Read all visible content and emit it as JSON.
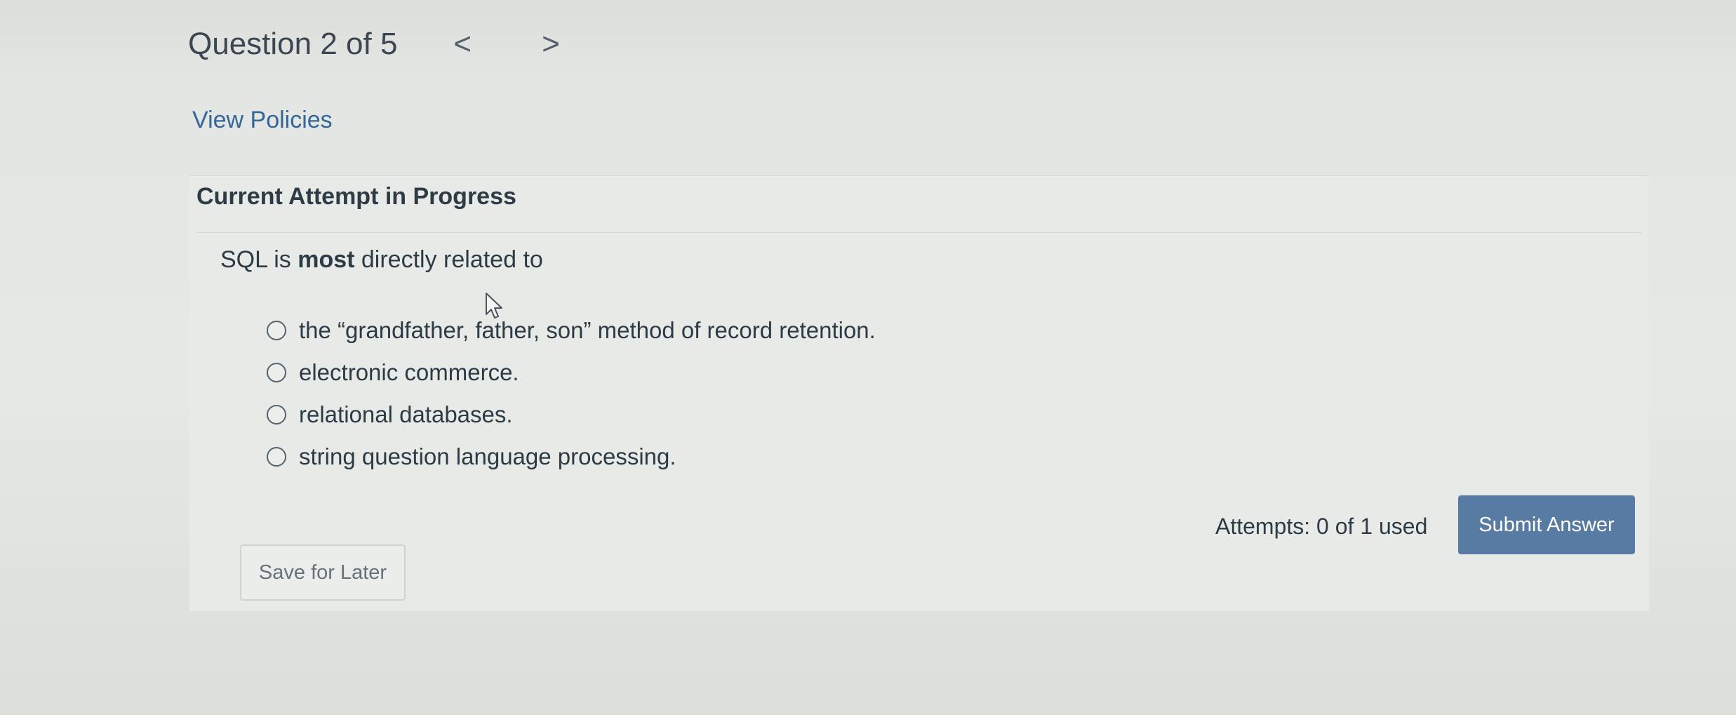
{
  "header": {
    "question_title": "Question 2 of 5",
    "prev_icon": "chevron-left-icon",
    "next_icon": "chevron-right-icon",
    "prev_glyph": "<",
    "next_glyph": ">"
  },
  "policies": {
    "link_label": "View Policies"
  },
  "attempt": {
    "heading": "Current Attempt in Progress"
  },
  "question": {
    "text_before": "SQL is ",
    "text_emphasis": "most",
    "text_after": " directly related to",
    "options": [
      {
        "label": "the “grandfather, father, son” method of record retention."
      },
      {
        "label": "electronic commerce."
      },
      {
        "label": "relational databases."
      },
      {
        "label": "string question language processing."
      }
    ]
  },
  "footer": {
    "attempts_text": "Attempts: 0 of 1 used",
    "submit_label": "Submit Answer",
    "save_label": "Save for Later"
  },
  "colors": {
    "link": "#336699",
    "submit_bg": "#587ba3",
    "text": "#2d3b45"
  }
}
